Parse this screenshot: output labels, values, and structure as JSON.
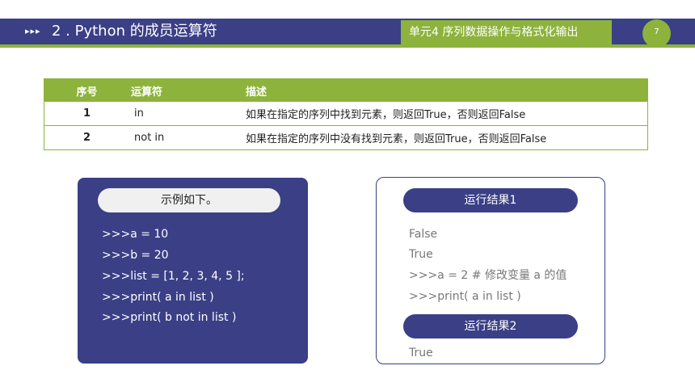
{
  "header": {
    "arrows": "▸▸▸",
    "title": "2 . Python 的成员运算符",
    "unit": "单元4 序列数据操作与格式化输出",
    "page": "7"
  },
  "table": {
    "headers": [
      "序号",
      "运算符",
      "描述"
    ],
    "rows": [
      [
        "1",
        "in",
        "如果在指定的序列中找到元素，则返回True，否则返回False"
      ],
      [
        "2",
        "not in",
        "如果在指定的序列中没有找到元素，则返回True，否则返回False"
      ]
    ]
  },
  "example": {
    "label": "示例如下。",
    "lines": [
      ">>>a = 10",
      ">>>b = 20",
      ">>>list = [1, 2, 3, 4, 5 ];",
      ">>>print( a in list )",
      ">>>print( b not in list )"
    ]
  },
  "result": {
    "label1": "运行结果1",
    "lines1": [
      "False",
      "True",
      ">>>a = 2 # 修改变量 a 的值",
      ">>>print( a in list )"
    ],
    "label2": "运行结果2",
    "lines2": [
      "True"
    ]
  },
  "colors": {
    "navy": "#3a3f86",
    "green": "#8db33c"
  }
}
